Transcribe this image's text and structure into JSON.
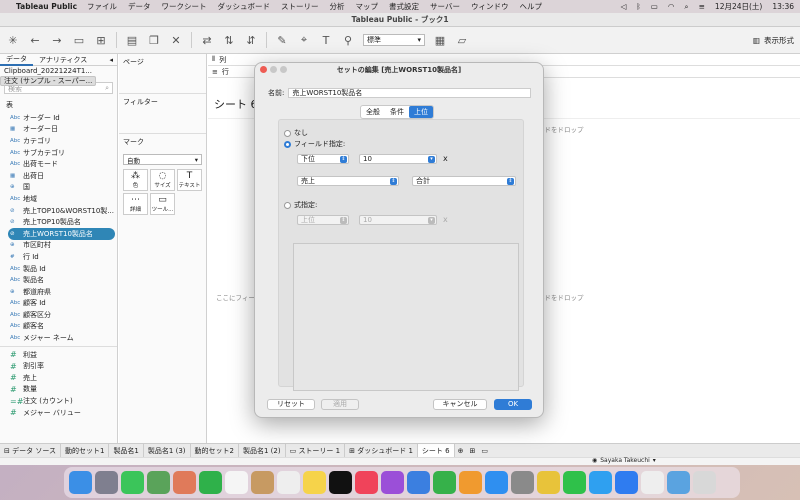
{
  "menubar": {
    "app_name": "Tableau Public",
    "items": [
      "ファイル",
      "データ",
      "ワークシート",
      "ダッシュボード",
      "ストーリー",
      "分析",
      "マップ",
      "書式設定",
      "サーバー",
      "ウィンドウ",
      "ヘルプ"
    ],
    "date": "12月24日(土)",
    "time": "13:36"
  },
  "window": {
    "title": "Tableau Public - ブック1",
    "toolbar_select": "標準",
    "show_me": "表示形式"
  },
  "data_panel": {
    "tabs": [
      "データ",
      "アナリティクス"
    ],
    "datasources": [
      "Clipboard_20221224T1...",
      "注文 (サンプル - スーパー..."
    ],
    "search_placeholder": "検索",
    "section": "表",
    "dimensions": [
      {
        "type": "Abc",
        "name": "オーダー Id"
      },
      {
        "type": "▦",
        "name": "オーダー日"
      },
      {
        "type": "Abc",
        "name": "カテゴリ"
      },
      {
        "type": "Abc",
        "name": "サブカテゴリ"
      },
      {
        "type": "Abc",
        "name": "出荷モード"
      },
      {
        "type": "▦",
        "name": "出荷日"
      },
      {
        "type": "⊕",
        "name": "国"
      },
      {
        "type": "Abc",
        "name": "地域"
      },
      {
        "type": "⊘",
        "name": "売上TOP10&WORST10製..."
      },
      {
        "type": "⊘",
        "name": "売上TOP10製品名"
      },
      {
        "type": "⊘",
        "name": "売上WORST10製品名"
      },
      {
        "type": "⊕",
        "name": "市区町村"
      },
      {
        "type": "#",
        "name": "行 Id"
      },
      {
        "type": "Abc",
        "name": "製品 Id"
      },
      {
        "type": "Abc",
        "name": "製品名"
      },
      {
        "type": "⊕",
        "name": "都道府県"
      },
      {
        "type": "Abc",
        "name": "顧客 Id"
      },
      {
        "type": "Abc",
        "name": "顧客区分"
      },
      {
        "type": "Abc",
        "name": "顧客名"
      },
      {
        "type": "Abc",
        "name": "メジャー ネーム"
      }
    ],
    "measures": [
      {
        "type": "#",
        "name": "利益"
      },
      {
        "type": "#",
        "name": "割引率"
      },
      {
        "type": "#",
        "name": "売上"
      },
      {
        "type": "#",
        "name": "数量"
      },
      {
        "type": "=#",
        "name": "注文 (カウント)"
      },
      {
        "type": "#",
        "name": "メジャー バリュー"
      }
    ]
  },
  "cards": {
    "pages": "ページ",
    "filters": "フィルター",
    "marks": "マーク",
    "marks_type": "自動",
    "mark_buttons": [
      {
        "icon": "⁂",
        "label": "色"
      },
      {
        "icon": "◌",
        "label": "サイズ"
      },
      {
        "icon": "T",
        "label": "テキスト"
      },
      {
        "icon": "⋯",
        "label": "詳細"
      },
      {
        "icon": "▭",
        "label": "ツール..."
      }
    ]
  },
  "canvas": {
    "columns": "列",
    "rows": "行",
    "sheet_title": "シート 6",
    "drop_field_1": "ルドをドロップ",
    "drop_field_2": "ルドをドロップ",
    "drop_left": "ここにフィー..."
  },
  "bottom_tabs": [
    "データ ソース",
    "動的セット1",
    "製品名1",
    "製品名1 (3)",
    "動的セット2",
    "製品名1 (2)",
    "ストーリー 1",
    "ダッシュボード 1",
    "シート 6"
  ],
  "user": "Sayaka Takeuchi",
  "dialog": {
    "title": "セットの編集 [売上WORST10製品名]",
    "name_label": "名前:",
    "name_value": "売上WORST10製品名",
    "tabs": [
      "全般",
      "条件",
      "上位"
    ],
    "active_tab": "上位",
    "opt_none": "なし",
    "opt_field": "フィールド指定:",
    "field_order": "下位",
    "field_count": "10",
    "field_by": "売上",
    "field_agg": "合計",
    "opt_formula": "式指定:",
    "formula_order": "上位",
    "formula_count": "10",
    "times": "x",
    "btn_reset": "リセット",
    "btn_apply": "適用",
    "btn_cancel": "キャンセル",
    "btn_ok": "OK"
  },
  "dock_apps": [
    {
      "name": "finder",
      "color": "#3b8fe6"
    },
    {
      "name": "launchpad",
      "color": "#7f7f8f"
    },
    {
      "name": "messages",
      "color": "#3bc55a"
    },
    {
      "name": "maps",
      "color": "#5aa35a"
    },
    {
      "name": "photos",
      "color": "#e07a5a"
    },
    {
      "name": "facetime",
      "color": "#2fb14a"
    },
    {
      "name": "calendar",
      "color": "#f5f5f5"
    },
    {
      "name": "contacts",
      "color": "#c79a62"
    },
    {
      "name": "reminders",
      "color": "#eeeeee"
    },
    {
      "name": "notes",
      "color": "#f6d34a"
    },
    {
      "name": "tv",
      "color": "#111111"
    },
    {
      "name": "music",
      "color": "#f0435a"
    },
    {
      "name": "podcasts",
      "color": "#9b4fd8"
    },
    {
      "name": "keynote",
      "color": "#3b7fe0"
    },
    {
      "name": "numbers",
      "color": "#36b14a"
    },
    {
      "name": "pages",
      "color": "#f09a2f"
    },
    {
      "name": "app-store",
      "color": "#2f8ff0"
    },
    {
      "name": "settings",
      "color": "#8a8a8a"
    },
    {
      "name": "chrome",
      "color": "#e8c33a"
    },
    {
      "name": "line",
      "color": "#2fc14a"
    },
    {
      "name": "twitter",
      "color": "#2fa0f0"
    },
    {
      "name": "zoom",
      "color": "#2f7cf0"
    },
    {
      "name": "tableau",
      "color": "#eeeeee"
    },
    {
      "name": "downloads",
      "color": "#5aa3e0"
    },
    {
      "name": "trash",
      "color": "#d8d8d8"
    }
  ],
  "colors": {
    "accent": "#2f7cd6",
    "highlight_field": "#2f86b6"
  }
}
